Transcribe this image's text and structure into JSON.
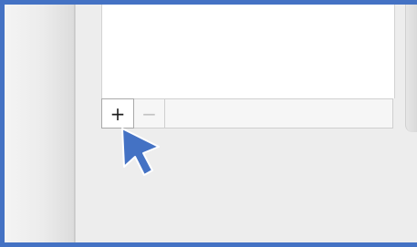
{
  "list_editor": {
    "add_button": {
      "label": "+",
      "icon": "plus-icon"
    },
    "remove_button": {
      "label": "−",
      "icon": "minus-icon",
      "enabled": false
    }
  },
  "colors": {
    "highlight_border": "#4472c4",
    "cursor": "#4472c4"
  },
  "pointer": {
    "icon": "mouse-pointer-icon"
  }
}
